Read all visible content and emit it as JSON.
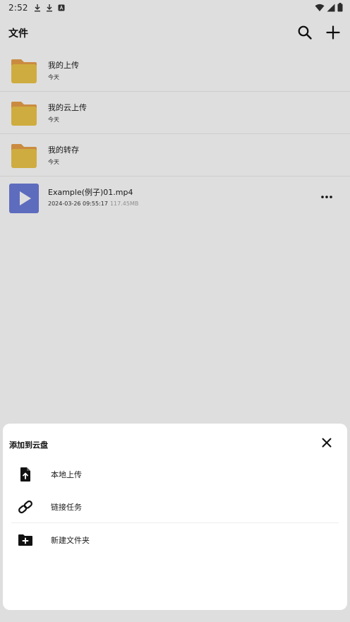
{
  "status_bar": {
    "time": "2:52"
  },
  "app_bar": {
    "title": "文件"
  },
  "files": [
    {
      "name": "我的上传",
      "subtitle": "今天",
      "type": "folder"
    },
    {
      "name": "我的云上传",
      "subtitle": "今天",
      "type": "folder"
    },
    {
      "name": "我的转存",
      "subtitle": "今天",
      "type": "folder"
    },
    {
      "name": "Example(例子)01.mp4",
      "date": "2024-03-26 09:55:17",
      "size": "117.45MB",
      "type": "video"
    }
  ],
  "sheet": {
    "title": "添加到云盘",
    "options": [
      {
        "label": "本地上传",
        "icon": "file-upload-icon"
      },
      {
        "label": "链接任务",
        "icon": "link-icon"
      },
      {
        "label": "新建文件夹",
        "icon": "folder-add-icon"
      }
    ]
  },
  "colors": {
    "folder_back": "#E8A04A",
    "folder_front": "#EEC649",
    "video_thumb": "#6D7DDB",
    "scrim": "rgba(0,0,0,0.13)"
  }
}
